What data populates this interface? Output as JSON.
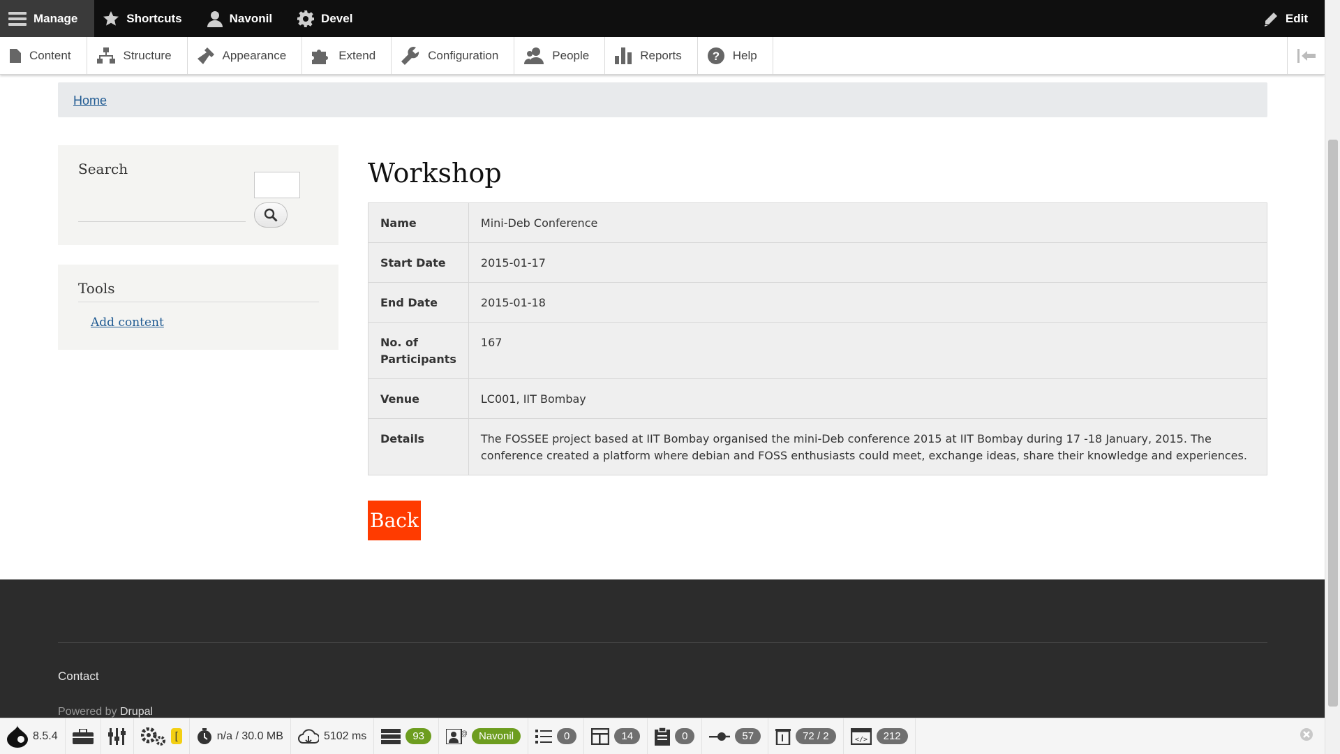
{
  "topbar": {
    "manage": "Manage",
    "shortcuts": "Shortcuts",
    "user": "Navonil",
    "devel": "Devel",
    "edit": "Edit"
  },
  "tray": {
    "items": [
      "Content",
      "Structure",
      "Appearance",
      "Extend",
      "Configuration",
      "People",
      "Reports",
      "Help"
    ]
  },
  "breadcrumb": {
    "home": "Home"
  },
  "sidebar": {
    "search_title": "Search",
    "tools_title": "Tools",
    "add_content": "Add content"
  },
  "main": {
    "title": "Workshop",
    "rows": [
      {
        "label": "Name",
        "value": "Mini-Deb Conference"
      },
      {
        "label": "Start Date",
        "value": "2015-01-17"
      },
      {
        "label": "End Date",
        "value": "2015-01-18"
      },
      {
        "label": "No. of Participants",
        "value": "167"
      },
      {
        "label": "Venue",
        "value": "LC001, IIT Bombay"
      },
      {
        "label": "Details",
        "value": "The FOSSEE project based at IIT Bombay organised the mini-Deb conference 2015 at IIT Bombay during 17 -18 January, 2015. The conference created a platform where debian and FOSS enthusiasts could meet, exchange ideas, share their knowledge and experiences."
      }
    ],
    "back": "Back"
  },
  "footer": {
    "contact": "Contact",
    "powered_prefix": "Powered by",
    "powered_link": "Drupal"
  },
  "devel": {
    "version": "8.5.4",
    "config_flag": "[",
    "memory": "n/a / 30.0 MB",
    "time": "5102 ms",
    "db_queries": "93",
    "user": "Navonil",
    "requests": "0",
    "blocks": "14",
    "forms": "0",
    "events": "57",
    "cache": "72 / 2",
    "theme": "212"
  },
  "colors": {
    "back_button": "#ff3b00",
    "link": "#1f5a92",
    "user_badge": "#6d9d1f"
  }
}
